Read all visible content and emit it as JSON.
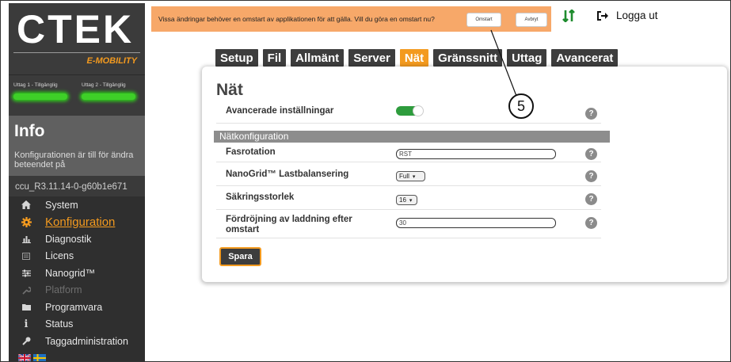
{
  "brand": {
    "logo_text": "CTEK",
    "sub": "E-MOBILITY"
  },
  "outlets": [
    {
      "label": "Uttag 1 - Tillgänglig"
    },
    {
      "label": "Uttag 2 - Tillgänglig"
    }
  ],
  "info": {
    "title": "Info",
    "text": "Konfigurationen är till för ändra beteendet på",
    "version": "ccu_R3.11.14-0-g60b1e671"
  },
  "menu": [
    {
      "label": "System",
      "icon": "home-icon"
    },
    {
      "label": "Konfiguration",
      "icon": "gear-icon",
      "active": true
    },
    {
      "label": "Diagnostik",
      "icon": "chart-icon"
    },
    {
      "label": "Licens",
      "icon": "license-icon"
    },
    {
      "label": "Nanogrid™",
      "icon": "sliders-icon"
    },
    {
      "label": "Platform",
      "icon": "wrench-icon",
      "disabled": true
    },
    {
      "label": "Programvara",
      "icon": "folder-icon"
    },
    {
      "label": "Status",
      "icon": "info-icon"
    },
    {
      "label": "Taggadministration",
      "icon": "key-icon"
    }
  ],
  "notification": {
    "message": "Vissa ändringar behöver en omstart av applikationen för att gälla. Vill du göra en omstart nu?",
    "restart_label": "Omstart",
    "cancel_label": "Avbryt"
  },
  "header": {
    "logout_label": "Logga ut"
  },
  "tabs": [
    {
      "label": "Setup"
    },
    {
      "label": "Fil"
    },
    {
      "label": "Allmänt"
    },
    {
      "label": "Server"
    },
    {
      "label": "Nät",
      "active": true
    },
    {
      "label": "Gränssnitt"
    },
    {
      "label": "Uttag"
    },
    {
      "label": "Avancerat"
    }
  ],
  "page": {
    "title": "Nät",
    "advanced_label": "Avancerade inställningar",
    "advanced_on": true,
    "section_title": "Nätkonfiguration",
    "fields": {
      "fasrotation": {
        "label": "Fasrotation",
        "value": "RST"
      },
      "nanogrid": {
        "label": "NanoGrid™ Lastbalansering",
        "value": "Full"
      },
      "fuse": {
        "label": "Säkringsstorlek",
        "value": "16"
      },
      "delay": {
        "label": "Fördröjning av laddning efter omstart",
        "value": "30"
      }
    },
    "help_symbol": "?",
    "save_label": "Spara"
  },
  "annotation": {
    "number": "5"
  },
  "colors": {
    "accent": "#f39a1f",
    "sidebar": "#2f2f2f",
    "toggle": "#2e9c3d",
    "notification": "#f7a869",
    "outlet_ok": "#3ecf28"
  }
}
